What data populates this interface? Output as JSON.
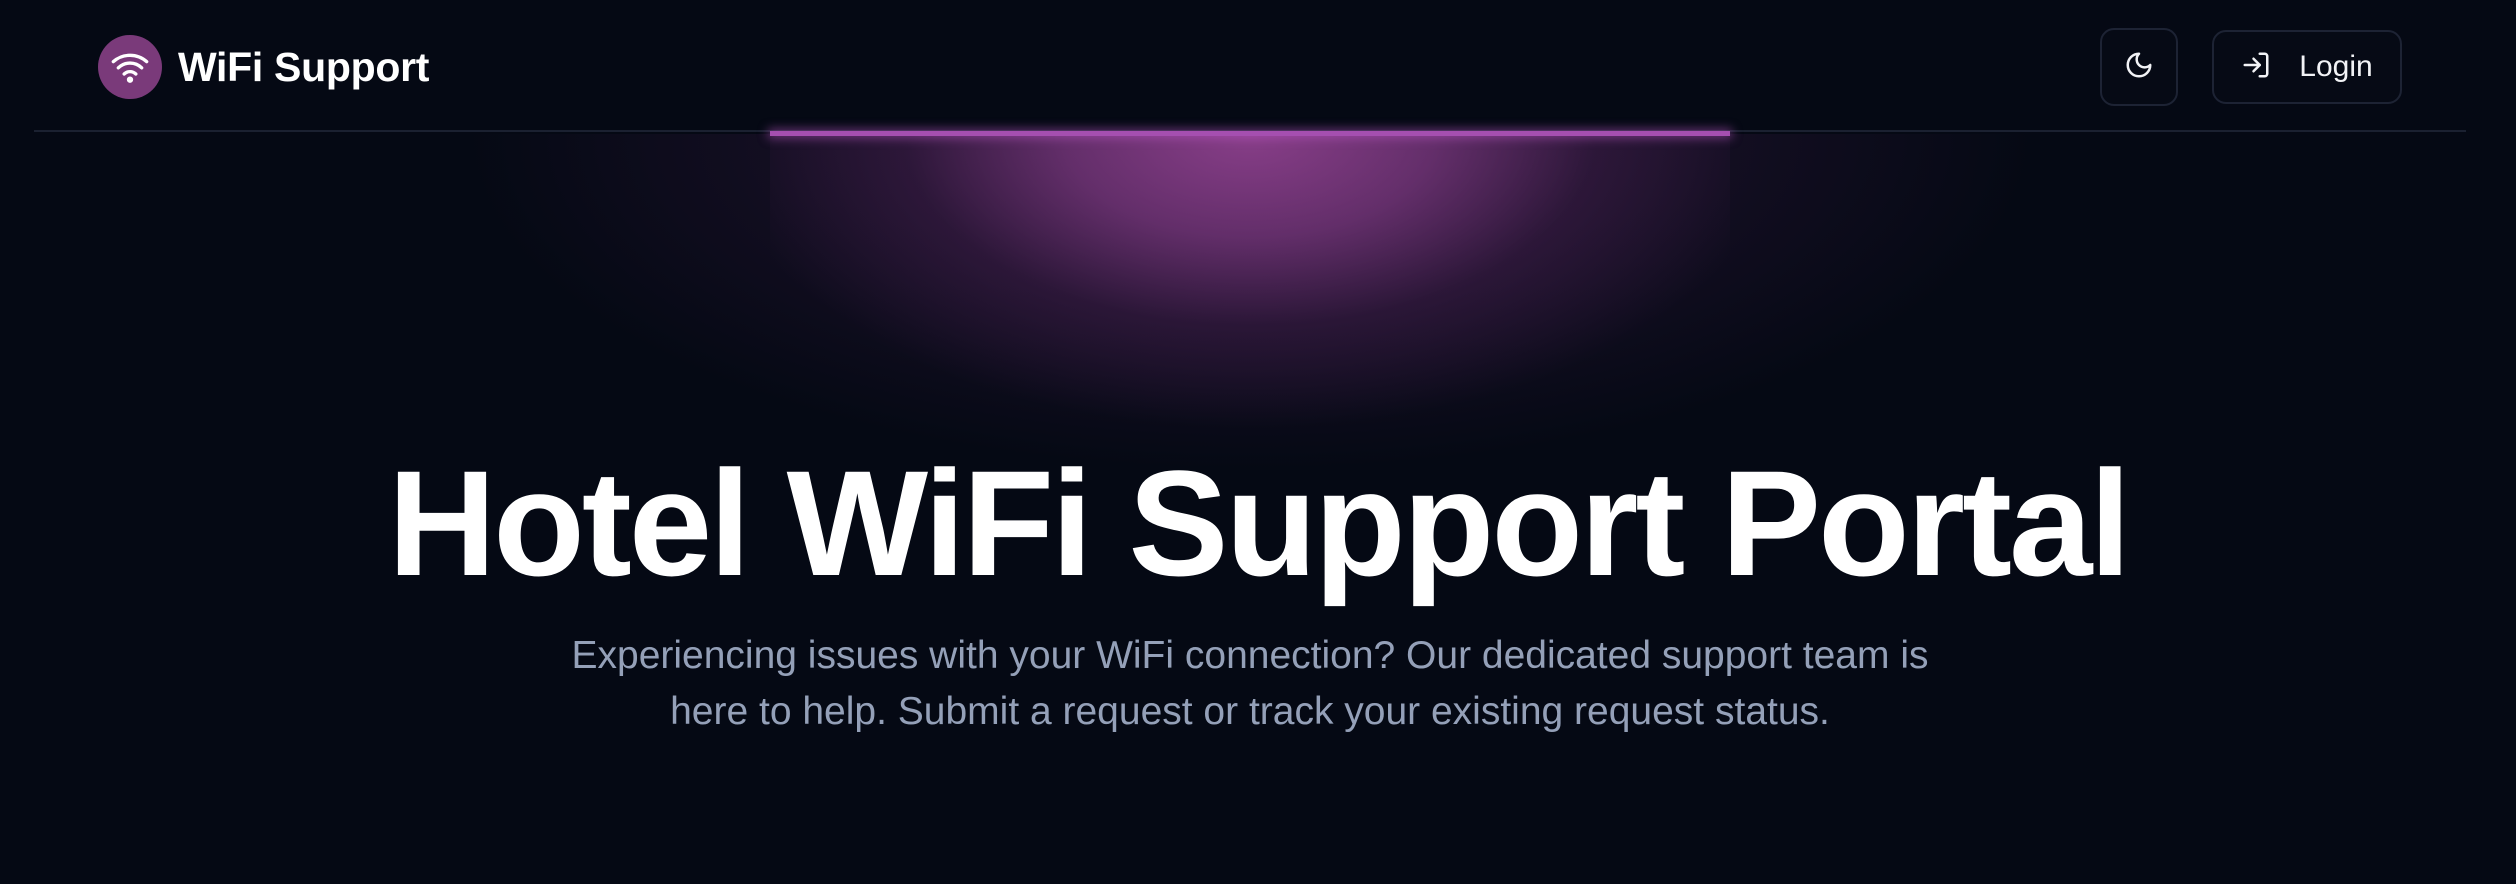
{
  "header": {
    "brand_name": "WiFi Support",
    "brand_icon": "wifi-icon",
    "theme_toggle_icon": "moon-icon",
    "login_icon": "log-in-icon",
    "login_label": "Login"
  },
  "hero": {
    "title": "Hotel WiFi Support Portal",
    "subtitle": "Experiencing issues with your WiFi connection? Our dedicated support team is here to help. Submit a request or track your existing request status."
  },
  "colors": {
    "background": "#050914",
    "accent": "#7a3a7a",
    "spotlight": "#a54fb0",
    "subtitle_text": "#94a0b8"
  }
}
